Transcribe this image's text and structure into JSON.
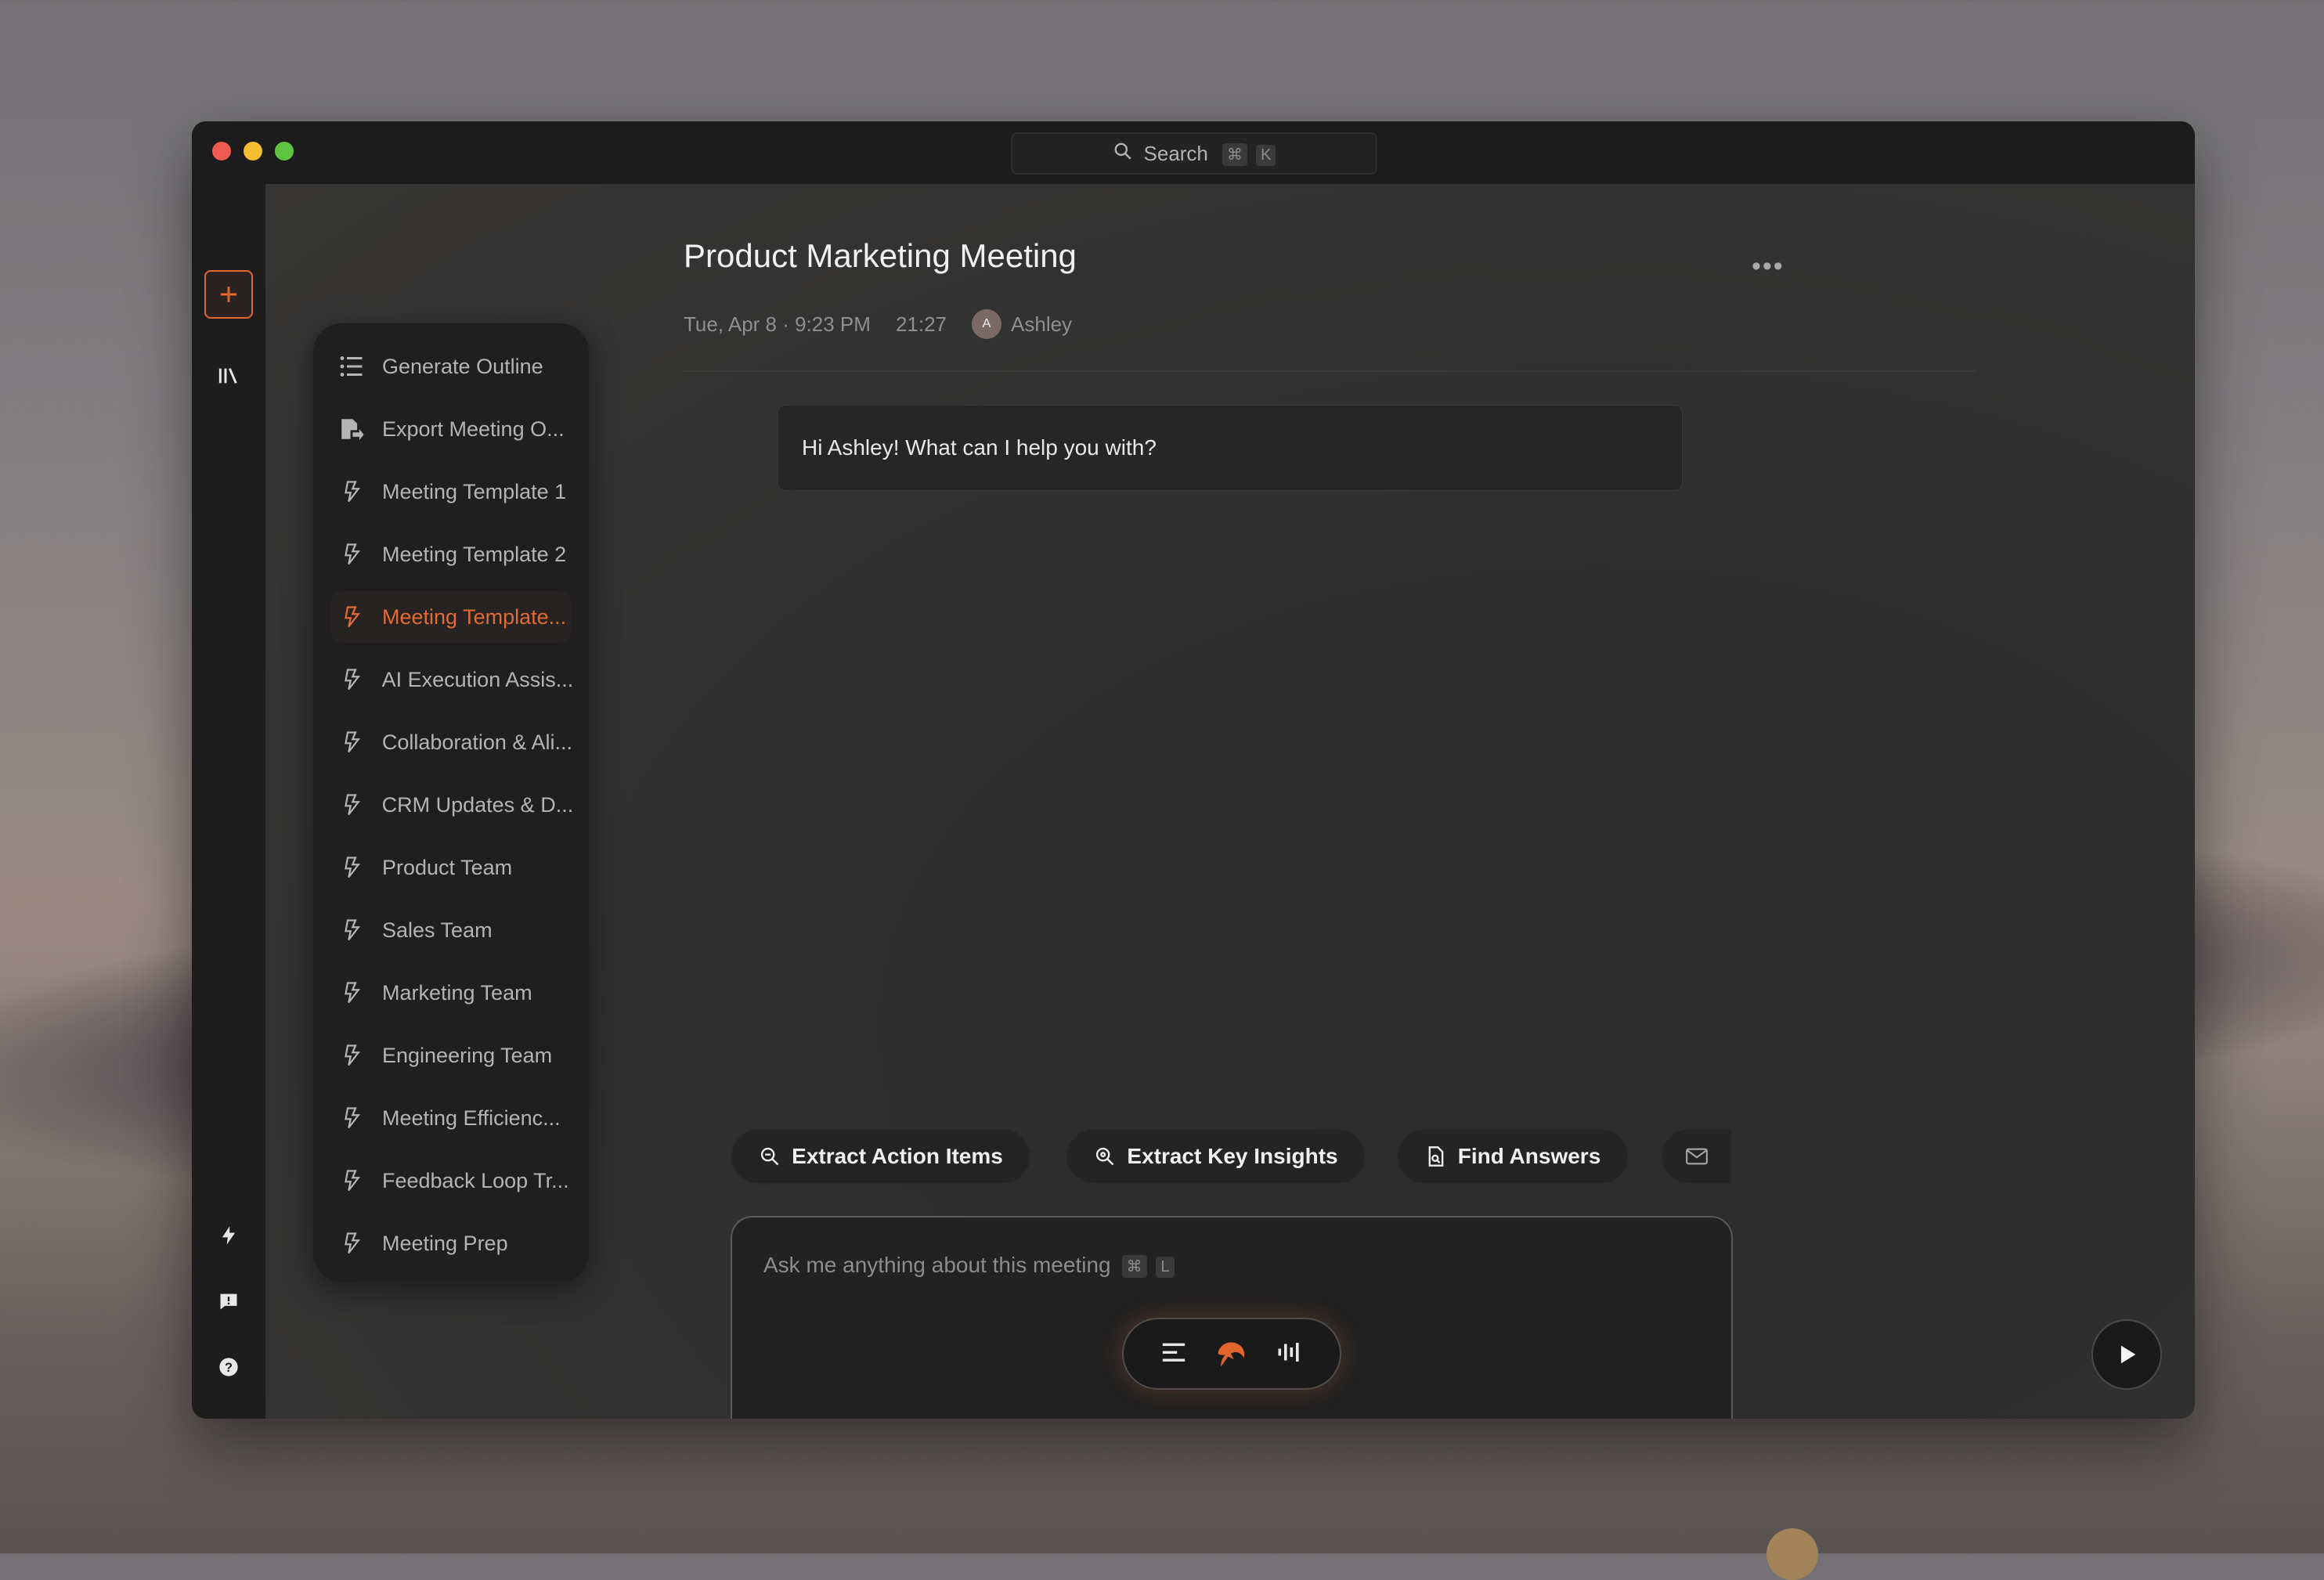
{
  "search": {
    "label": "Search",
    "key1": "⌘",
    "key2": "K"
  },
  "menu": {
    "items": [
      {
        "label": "Generate Outline",
        "icon": "list-icon"
      },
      {
        "label": "Export Meeting O...",
        "icon": "export-icon"
      },
      {
        "label": "Meeting Template 1",
        "icon": "bolt-icon"
      },
      {
        "label": "Meeting Template 2",
        "icon": "bolt-icon"
      },
      {
        "label": "Meeting Template...",
        "icon": "bolt-icon",
        "active": true
      },
      {
        "label": "AI Execution Assis...",
        "icon": "bolt-icon"
      },
      {
        "label": "Collaboration & Ali...",
        "icon": "bolt-icon"
      },
      {
        "label": "CRM Updates & D...",
        "icon": "bolt-icon"
      },
      {
        "label": "Product Team",
        "icon": "bolt-icon"
      },
      {
        "label": "Sales Team",
        "icon": "bolt-icon"
      },
      {
        "label": "Marketing Team",
        "icon": "bolt-icon"
      },
      {
        "label": "Engineering Team",
        "icon": "bolt-icon"
      },
      {
        "label": "Meeting Efficienc...",
        "icon": "bolt-icon"
      },
      {
        "label": "Feedback Loop Tr...",
        "icon": "bolt-icon"
      },
      {
        "label": "Meeting Prep",
        "icon": "bolt-icon"
      }
    ]
  },
  "meeting": {
    "title": "Product Marketing Meeting",
    "date": "Tue, Apr 8 · 9:23 PM",
    "duration": "21:27",
    "avatar_initial": "A",
    "owner": "Ashley"
  },
  "chat": {
    "greeting": "Hi Ashley! What can I help you with?"
  },
  "actions": {
    "extract_action_items": "Extract Action Items",
    "extract_key_insights": "Extract Key Insights",
    "find_answers": "Find Answers"
  },
  "composer": {
    "placeholder": "Ask me anything about this meeting",
    "key1": "⌘",
    "key2": "L"
  },
  "colors": {
    "accent": "#e0662c",
    "background": "#2f2f2f",
    "sidebar": "#1d1d1d"
  }
}
